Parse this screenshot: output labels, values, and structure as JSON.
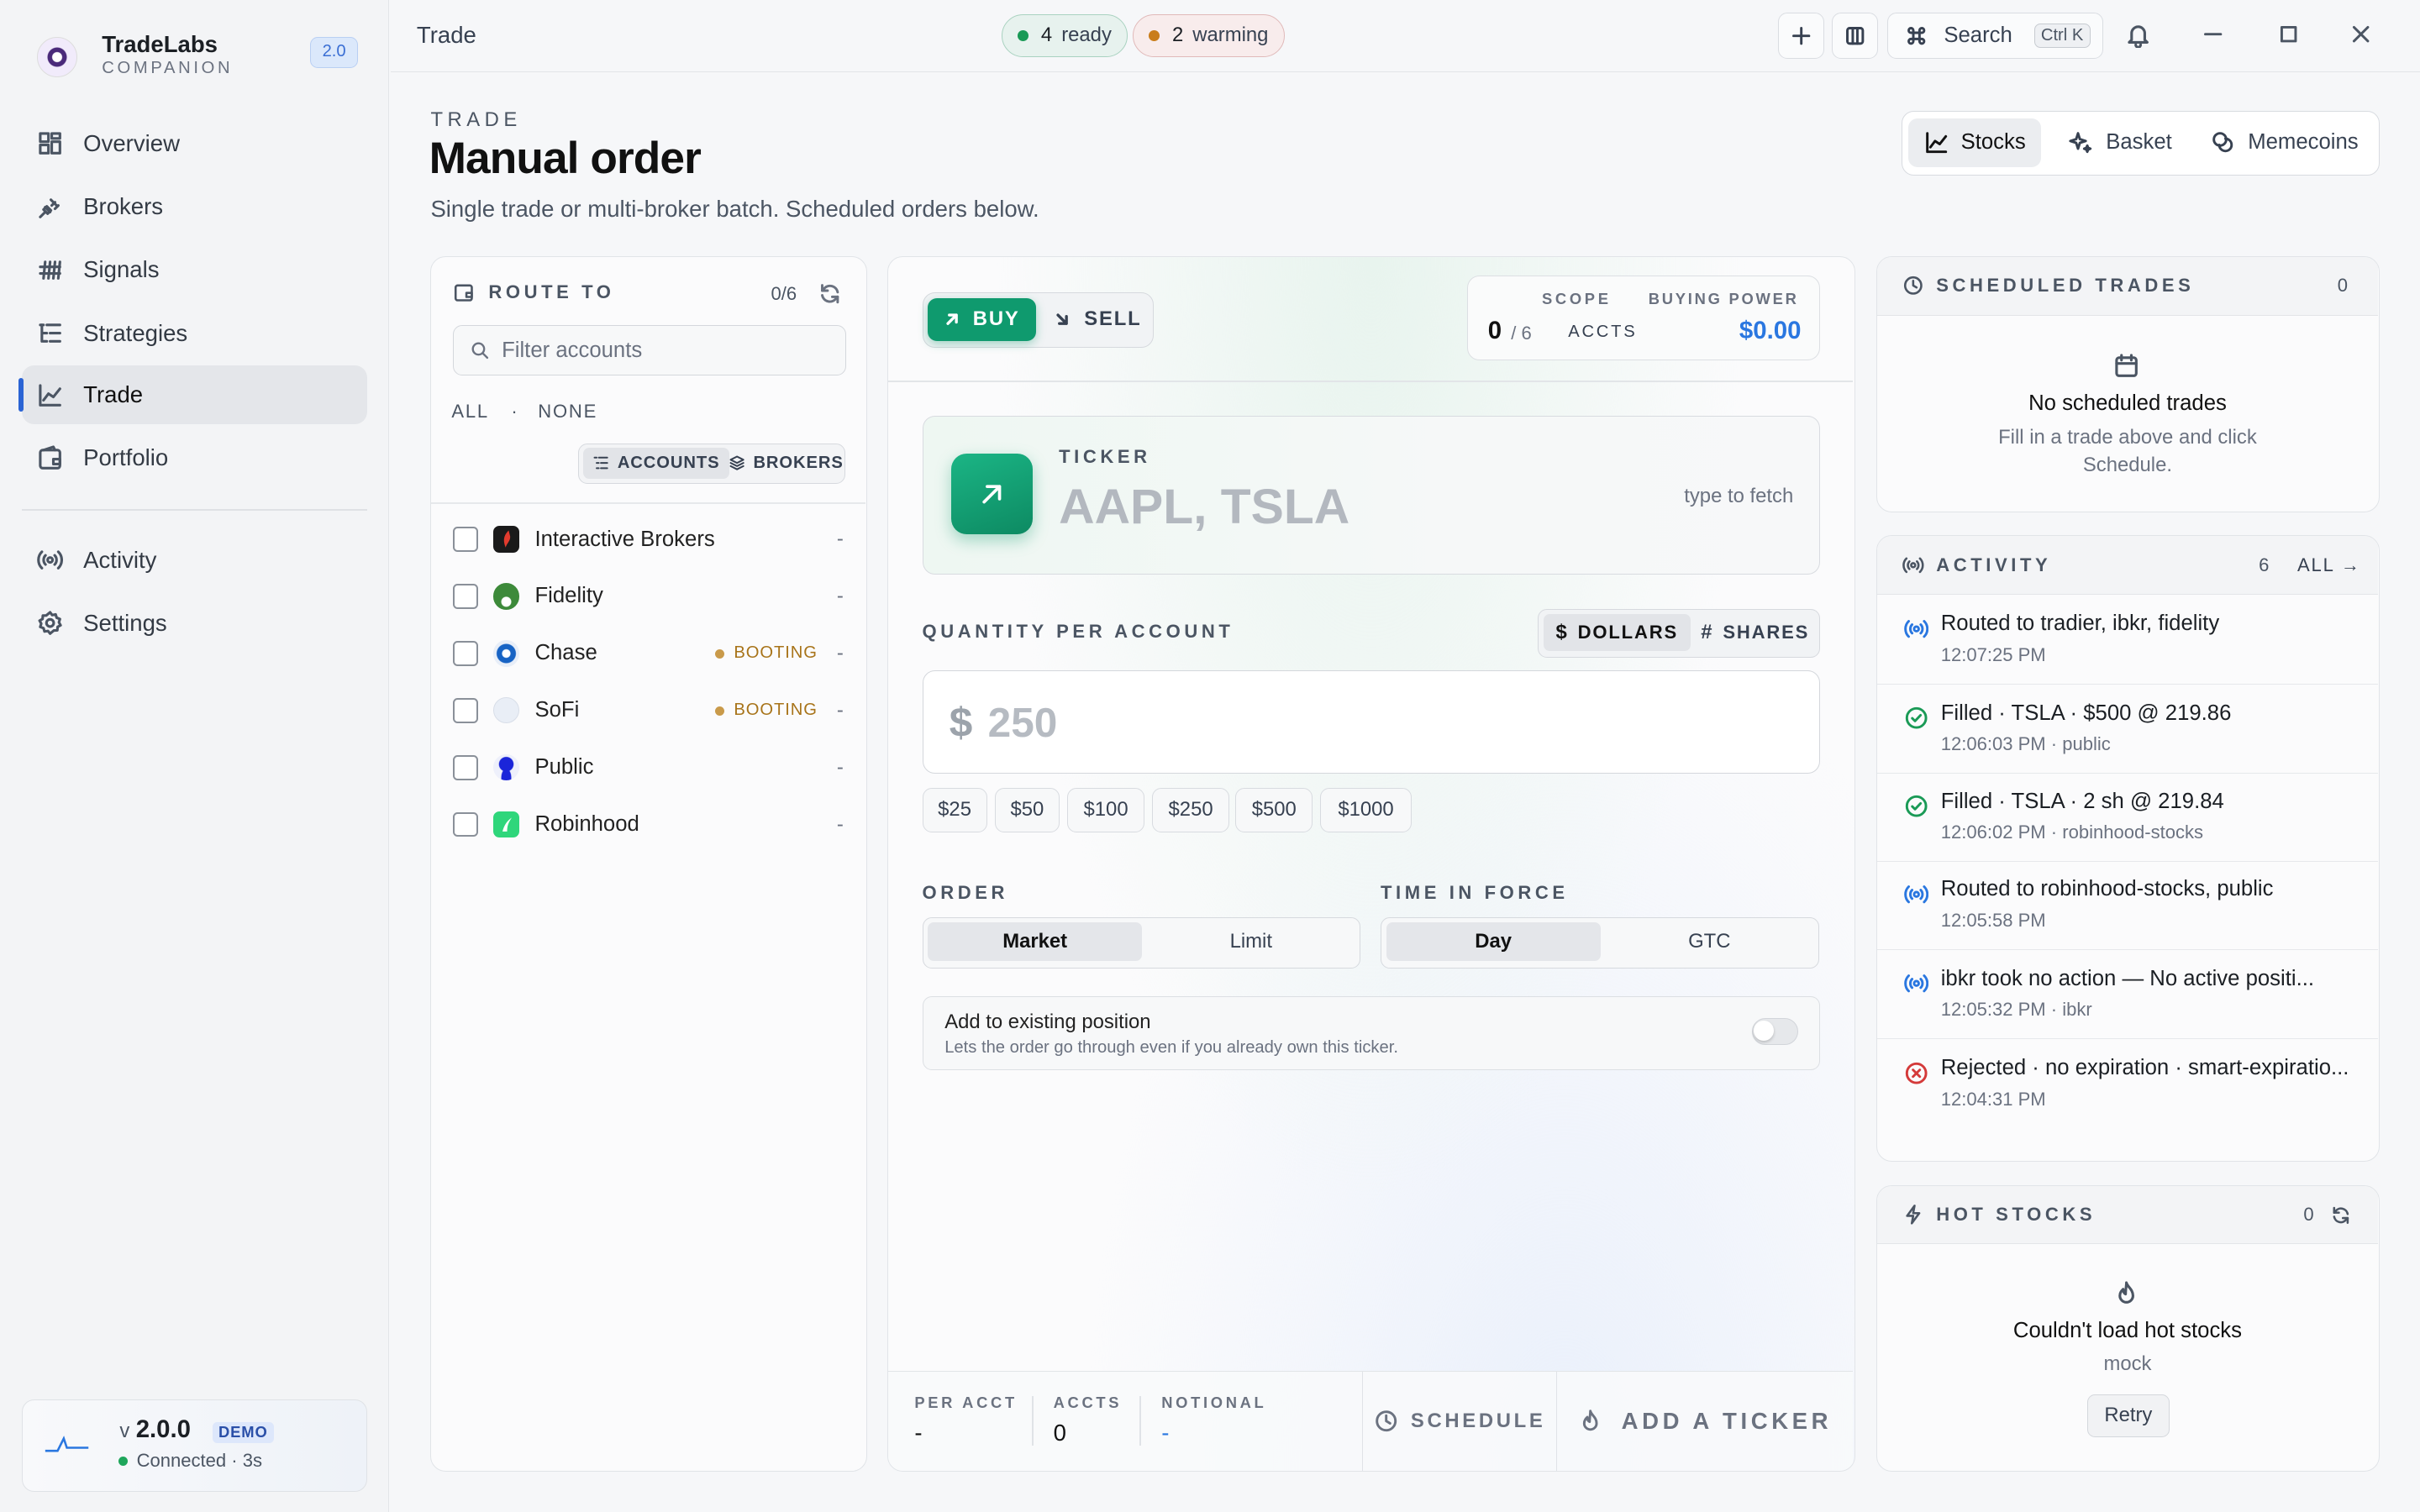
{
  "app": {
    "name": "TradeLabs",
    "subtitle": "COMPANION",
    "version_badge": "2.0"
  },
  "sidebar": {
    "items": [
      {
        "label": "Overview",
        "icon": "grid-icon"
      },
      {
        "label": "Brokers",
        "icon": "plug-icon"
      },
      {
        "label": "Signals",
        "icon": "signal-icon"
      },
      {
        "label": "Strategies",
        "icon": "list-icon"
      },
      {
        "label": "Trade",
        "icon": "chart-icon",
        "active": true
      },
      {
        "label": "Portfolio",
        "icon": "wallet-icon"
      }
    ],
    "secondary": [
      {
        "label": "Activity",
        "icon": "broadcast-icon"
      },
      {
        "label": "Settings",
        "icon": "gear-icon"
      }
    ],
    "status": {
      "v_prefix": "v",
      "version": "2.0.0",
      "badge": "DEMO",
      "connection": "Connected · 3s"
    }
  },
  "topbar": {
    "breadcrumb": "Trade",
    "ready": {
      "count": "4",
      "label": "ready"
    },
    "warming": {
      "count": "2",
      "label": "warming"
    },
    "search_label": "Search",
    "search_shortcut": "Ctrl K"
  },
  "header": {
    "eyebrow": "TRADE",
    "title": "Manual order",
    "subtitle": "Single trade or multi-broker batch. Scheduled orders below.",
    "modes": [
      "Stocks",
      "Basket",
      "Memecoins"
    ],
    "active_mode": "Stocks"
  },
  "route": {
    "title": "ROUTE TO",
    "count": "0/6",
    "filter_placeholder": "Filter accounts",
    "select_all": "ALL",
    "select_sep": "·",
    "select_none": "NONE",
    "view_accounts": "ACCOUNTS",
    "view_brokers": "BROKERS",
    "accounts": [
      {
        "name": "Interactive Brokers",
        "status": "",
        "value": "-"
      },
      {
        "name": "Fidelity",
        "status": "",
        "value": "-"
      },
      {
        "name": "Chase",
        "status": "BOOTING",
        "value": "-"
      },
      {
        "name": "SoFi",
        "status": "BOOTING",
        "value": "-"
      },
      {
        "name": "Public",
        "status": "",
        "value": "-"
      },
      {
        "name": "Robinhood",
        "status": "",
        "value": "-"
      }
    ]
  },
  "order": {
    "buy_label": "BUY",
    "sell_label": "SELL",
    "scope_label": "SCOPE",
    "scope_value": "0",
    "scope_total": "/ 6",
    "scope_unit": "ACCTS",
    "buying_power_label": "BUYING POWER",
    "buying_power_value": "$0.00",
    "ticker_label": "TICKER",
    "ticker_placeholder": "AAPL, TSLA",
    "ticker_hint": "type to fetch",
    "quantity_label": "QUANTITY PER ACCOUNT",
    "unit_dollars": "DOLLARS",
    "unit_shares": "SHARES",
    "currency_symbol": "$",
    "amount_placeholder": "250",
    "presets": [
      "$25",
      "$50",
      "$100",
      "$250",
      "$500",
      "$1000"
    ],
    "order_label": "ORDER",
    "order_types": [
      "Market",
      "Limit"
    ],
    "tif_label": "TIME IN FORCE",
    "tif_options": [
      "Day",
      "GTC"
    ],
    "add_position_title": "Add to existing position",
    "add_position_desc": "Lets the order go through even if you already own this ticker.",
    "footer": {
      "per_acct_label": "PER ACCT",
      "per_acct_value": "-",
      "accts_label": "ACCTS",
      "accts_value": "0",
      "notional_label": "NOTIONAL",
      "notional_value": "-",
      "schedule_label": "SCHEDULE",
      "submit_label": "ADD A TICKER"
    }
  },
  "scheduled": {
    "title": "SCHEDULED TRADES",
    "count": "0",
    "empty_title": "No scheduled trades",
    "empty_desc": "Fill in a trade above and click Schedule."
  },
  "activity": {
    "title": "ACTIVITY",
    "count": "6",
    "all_label": "ALL →",
    "items": [
      {
        "kind": "routed",
        "text": "Routed to tradier, ibkr, fidelity",
        "time": "12:07:25 PM",
        "source": ""
      },
      {
        "kind": "filled",
        "text": "Filled · TSLA · $500 @ 219.86",
        "time": "12:06:03 PM",
        "source": "public"
      },
      {
        "kind": "filled",
        "text": "Filled · TSLA · 2 sh @ 219.84",
        "time": "12:06:02 PM",
        "source": "robinhood-stocks"
      },
      {
        "kind": "routed",
        "text": "Routed to robinhood-stocks, public",
        "time": "12:05:58 PM",
        "source": ""
      },
      {
        "kind": "routed",
        "text": "ibkr took no action — No active positi...",
        "time": "12:05:32 PM",
        "source": "ibkr"
      },
      {
        "kind": "rejected",
        "text": "Rejected · no expiration · smart-expiratio...",
        "time": "12:04:31 PM",
        "source": ""
      }
    ]
  },
  "hot": {
    "title": "HOT STOCKS",
    "count": "0",
    "error_title": "Couldn't load hot stocks",
    "error_desc": "mock",
    "retry_label": "Retry"
  },
  "colors": {
    "accent": "#2a63d4",
    "buy": "#0f9a6e",
    "buying_power": "#2a77e0",
    "booting": "#a8741a"
  }
}
